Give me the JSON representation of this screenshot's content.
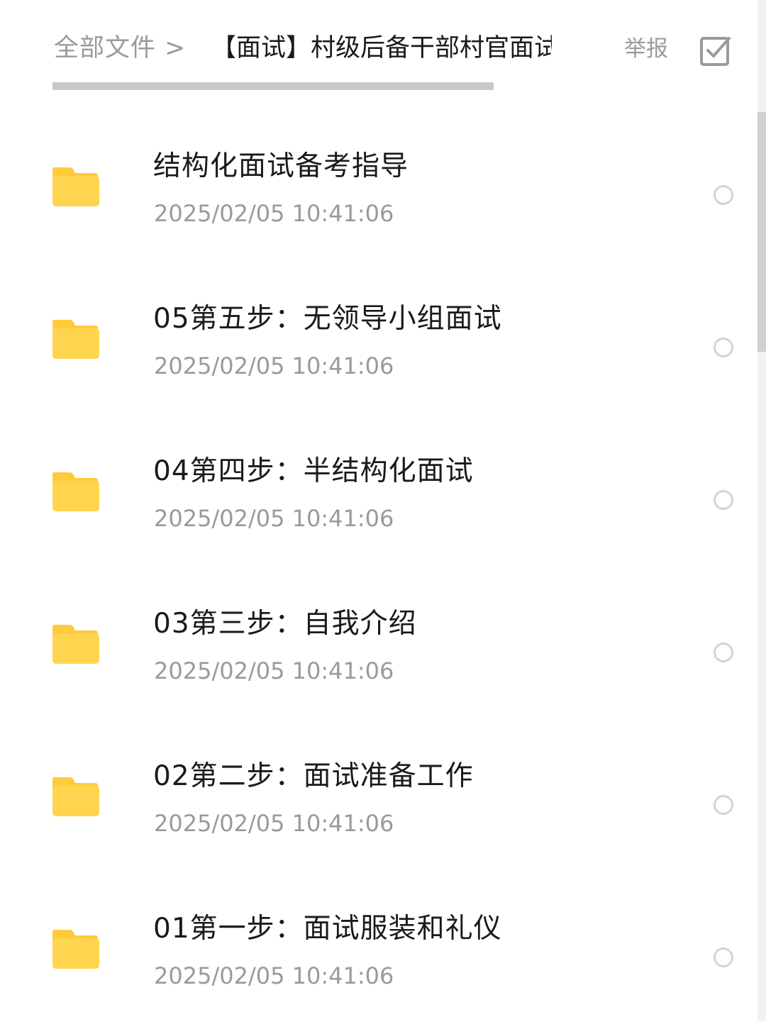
{
  "header": {
    "breadcrumb_root": "全部文件",
    "breadcrumb_separator": ">",
    "breadcrumb_current": "【面试】村级后备干部村官面试",
    "report_label": "举报",
    "multi_select_icon": "checkbox-check-icon"
  },
  "colors": {
    "folder": "#ffd54f",
    "folder_tab": "#ffcb3a",
    "title_text": "#1a1a1a",
    "muted_text": "#9a9a9a",
    "radio_border": "#d4d4d4"
  },
  "files": [
    {
      "name": "结构化面试备考指导",
      "date": "2025/02/05  10:41:06",
      "icon": "folder-icon"
    },
    {
      "name": "05第五步：无领导小组面试",
      "date": "2025/02/05  10:41:06",
      "icon": "folder-icon"
    },
    {
      "name": "04第四步：半结构化面试",
      "date": "2025/02/05  10:41:06",
      "icon": "folder-icon"
    },
    {
      "name": "03第三步：自我介绍",
      "date": "2025/02/05  10:41:06",
      "icon": "folder-icon"
    },
    {
      "name": "02第二步：面试准备工作",
      "date": "2025/02/05  10:41:06",
      "icon": "folder-icon"
    },
    {
      "name": "01第一步：面试服装和礼仪",
      "date": "2025/02/05  10:41:06",
      "icon": "folder-icon"
    }
  ]
}
